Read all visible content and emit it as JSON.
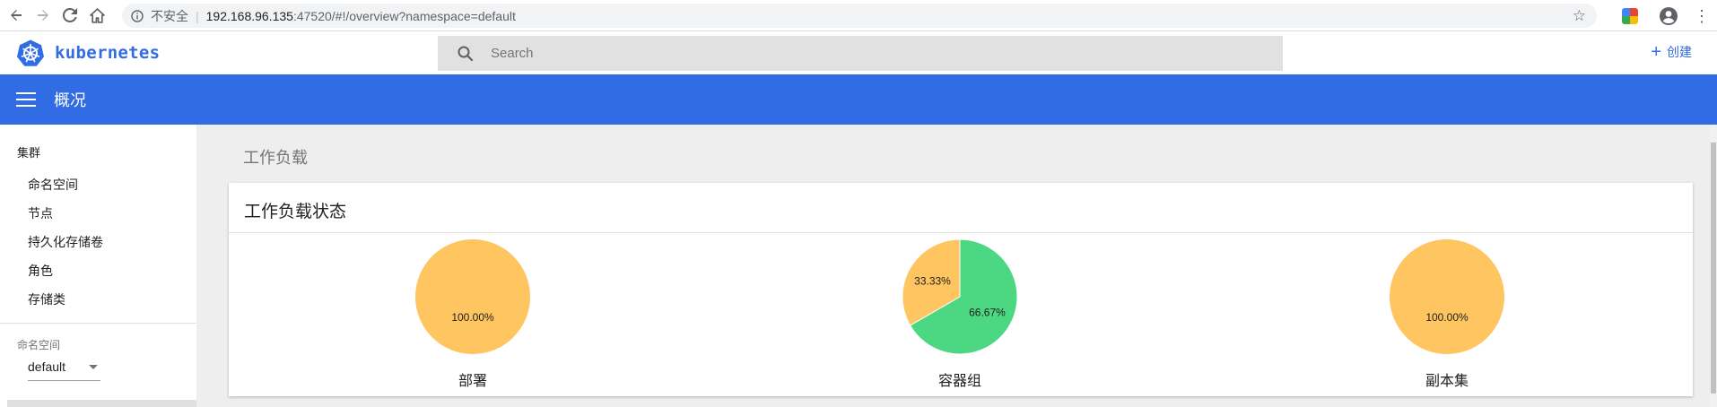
{
  "browser": {
    "insecure_label": "不安全",
    "url_host": "192.168.96.135",
    "url_rest": ":47520/#!/overview?namespace=default"
  },
  "app": {
    "logo_text": "kubernetes",
    "search_placeholder": "Search",
    "create_label": "创建"
  },
  "title_bar": {
    "title": "概况"
  },
  "sidebar": {
    "cluster_heading": "集群",
    "items": [
      {
        "label": "命名空间"
      },
      {
        "label": "节点"
      },
      {
        "label": "持久化存储卷"
      },
      {
        "label": "角色"
      },
      {
        "label": "存储类"
      }
    ],
    "namespace_label": "命名空间",
    "namespace_value": "default"
  },
  "main": {
    "section_title": "工作负载",
    "card_title": "工作负载状态"
  },
  "colors": {
    "brand": "#326ce5",
    "pie_orange": "#ffc560",
    "pie_green": "#4cd783"
  },
  "chart_data": [
    {
      "type": "pie",
      "title": "部署",
      "slices": [
        {
          "value": 100.0,
          "label": "100.00%",
          "color": "#ffc560"
        }
      ]
    },
    {
      "type": "pie",
      "title": "容器组",
      "slices": [
        {
          "value": 66.67,
          "label": "66.67%",
          "color": "#4cd783"
        },
        {
          "value": 33.33,
          "label": "33.33%",
          "color": "#ffc560"
        }
      ]
    },
    {
      "type": "pie",
      "title": "副本集",
      "slices": [
        {
          "value": 100.0,
          "label": "100.00%",
          "color": "#ffc560"
        }
      ]
    }
  ]
}
